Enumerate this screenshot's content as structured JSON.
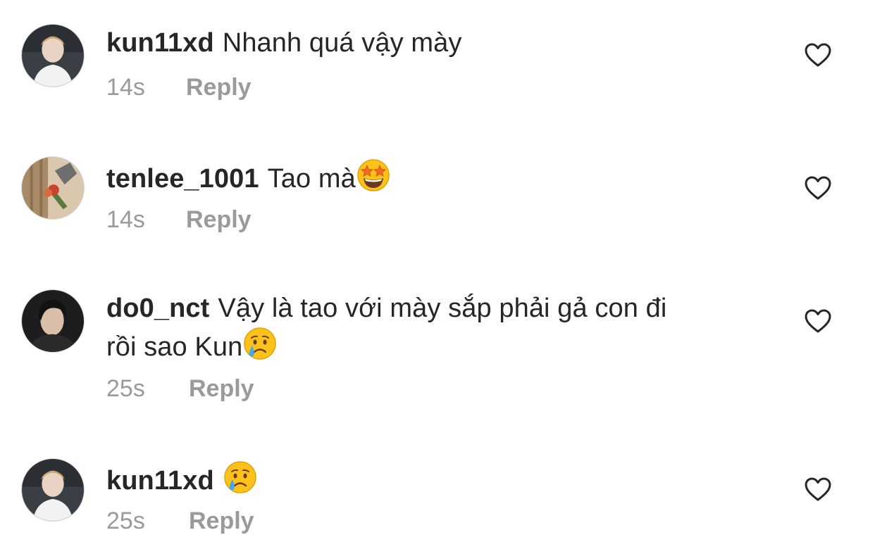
{
  "comments": [
    {
      "username": "kun11xd",
      "text": "Nhanh quá vậy mày",
      "text_line2": "",
      "emoji": "",
      "time": "14s",
      "reply_label": "Reply",
      "avatar": "avatar-kun11xd",
      "like_icon": "heart-outline-icon"
    },
    {
      "username": "tenlee_1001",
      "text": "Tao mà",
      "text_line2": "",
      "emoji": "star-struck-emoji",
      "time": "14s",
      "reply_label": "Reply",
      "avatar": "avatar-tenlee_1001",
      "like_icon": "heart-outline-icon"
    },
    {
      "username": "do0_nct",
      "text": "Vậy là tao với mày sắp phải gả con đi",
      "text_line2": "rồi sao Kun",
      "emoji": "crying-face-emoji",
      "time": "25s",
      "reply_label": "Reply",
      "avatar": "avatar-do0_nct",
      "like_icon": "heart-outline-icon"
    },
    {
      "username": "kun11xd",
      "text": "",
      "text_line2": "",
      "emoji": "crying-face-emoji",
      "time": "25s",
      "reply_label": "Reply",
      "avatar": "avatar-kun11xd",
      "like_icon": "heart-outline-icon"
    }
  ],
  "colors": {
    "text": "#262626",
    "meta": "#9a9a9a",
    "heart_stroke": "#262626",
    "emoji_yellow": "#fcc21b",
    "tear_blue": "#42a5f5"
  }
}
